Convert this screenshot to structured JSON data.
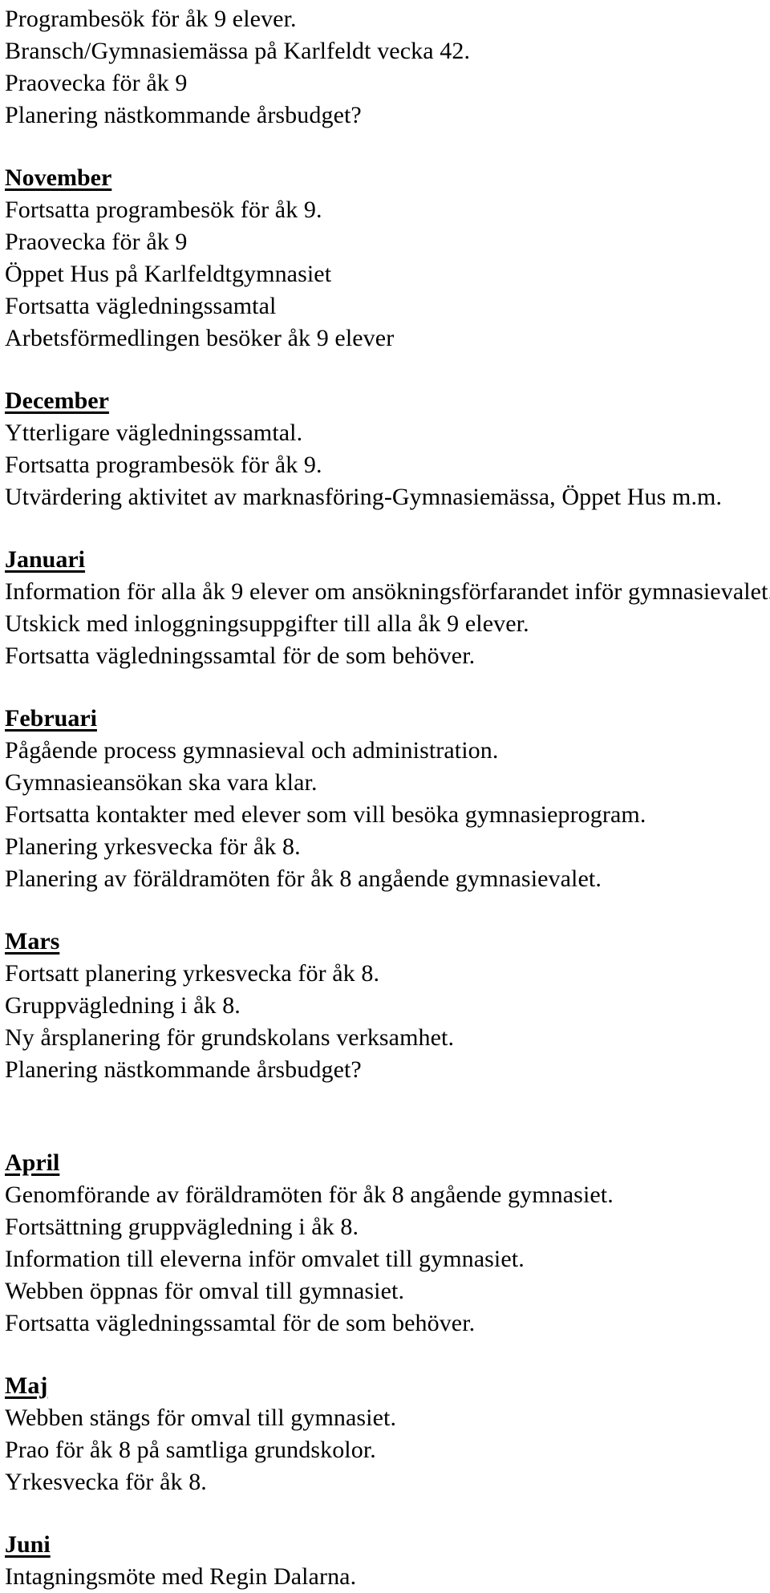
{
  "document": {
    "intro_lines": [
      "Programbesök för åk 9 elever.",
      "Bransch/Gymnasiemässa på Karlfeldt vecka 42.",
      "Praovecka för åk 9",
      "Planering nästkommande årsbudget?"
    ],
    "sections": [
      {
        "month": "November",
        "gap_before": 1,
        "lines": [
          "Fortsatta programbesök för åk 9.",
          "Praovecka för åk 9",
          "Öppet Hus på Karlfeldtgymnasiet",
          "Fortsatta vägledningssamtal",
          "Arbetsförmedlingen besöker åk 9 elever"
        ]
      },
      {
        "month": "December",
        "gap_before": 1,
        "lines": [
          "Ytterligare vägledningssamtal.",
          "Fortsatta programbesök för åk 9.",
          "Utvärdering aktivitet av marknasföring-Gymnasiemässa, Öppet Hus m.m."
        ]
      },
      {
        "month": "Januari",
        "gap_before": 1,
        "lines": [
          "Information för alla åk 9 elever om ansökningsförfarandet inför gymnasievalet.",
          "Utskick med inloggningsuppgifter till alla åk 9 elever.",
          "Fortsatta vägledningssamtal för de som behöver."
        ]
      },
      {
        "month": "Februari",
        "gap_before": 1,
        "lines": [
          "Pågående process gymnasieval och administration.",
          "Gymnasieansökan ska vara klar.",
          "Fortsatta kontakter med elever som vill besöka gymnasieprogram.",
          "Planering yrkesvecka för åk 8.",
          "Planering av föräldramöten för åk 8 angående gymnasievalet."
        ]
      },
      {
        "month": "Mars",
        "gap_before": 1,
        "lines": [
          "Fortsatt planering yrkesvecka för åk 8.",
          "Gruppvägledning i åk 8.",
          "Ny årsplanering för grundskolans verksamhet.",
          "Planering nästkommande årsbudget?"
        ]
      },
      {
        "month": "April",
        "gap_before": 2,
        "lines": [
          "Genomförande av föräldramöten för åk 8 angående gymnasiet.",
          "Fortsättning gruppvägledning i åk 8.",
          "Information till eleverna inför omvalet till gymnasiet.",
          "Webben öppnas för omval till gymnasiet.",
          "Fortsatta vägledningssamtal för de som behöver."
        ]
      },
      {
        "month": "Maj",
        "gap_before": 1,
        "lines": [
          "Webben stängs för omval till gymnasiet.",
          "Prao för åk 8 på samtliga grundskolor.",
          "Yrkesvecka för åk 8."
        ]
      },
      {
        "month": "Juni",
        "gap_before": 1,
        "lines": [
          "Intagningsmöte med Regin Dalarna."
        ]
      }
    ]
  }
}
